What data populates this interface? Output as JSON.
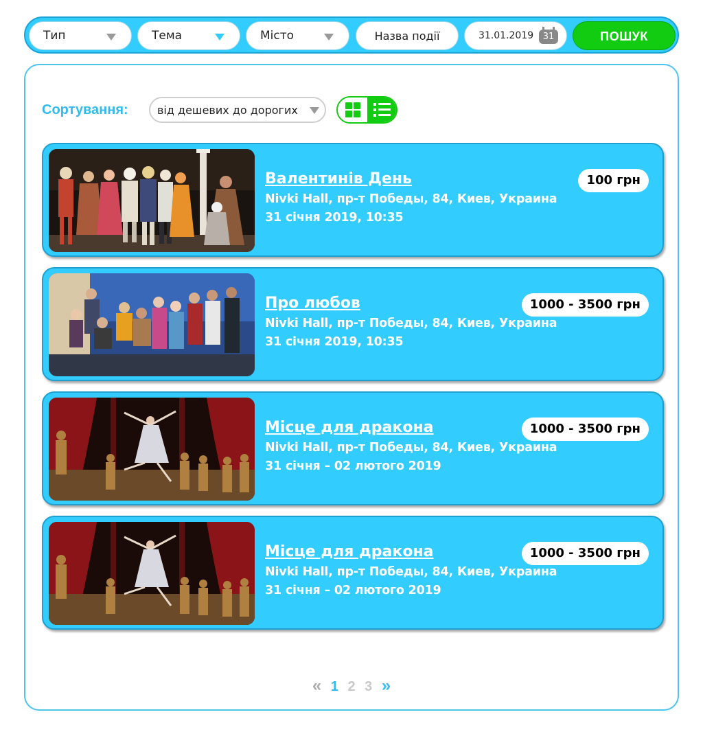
{
  "filters": {
    "type_label": "Тип",
    "theme_label": "Тема",
    "city_label": "Місто",
    "name_placeholder": "Назва події",
    "date_value": "31.01.2019",
    "calendar_day": "31",
    "search_label": "ПОШУК"
  },
  "sort": {
    "label": "Сортування:",
    "selected": "від дешевих до дорогих"
  },
  "view_toggle": {
    "active": "list"
  },
  "events": [
    {
      "title": "Валентинів День",
      "venue": "Nivki Hall, пр-т Победы, 84, Киев, Украина",
      "date": "31 січня 2019, 10:35",
      "price": "100 грн",
      "image": "theatre-costume-cast-photo"
    },
    {
      "title": "Про любов",
      "venue": "Nivki Hall, пр-т Победы, 84, Киев, Украина",
      "date": "31 січня 2019, 10:35",
      "price": "1000 - 3500 грн",
      "image": "comedy-troupe-photo"
    },
    {
      "title": "Місце для дракона",
      "venue": "Nivki Hall, пр-т Победы, 84, Киев, Украина",
      "date": "31 січня – 02 лютого 2019",
      "price": "1000 - 3500 грн",
      "image": "ballet-stage-photo"
    },
    {
      "title": "Місце для дракона",
      "venue": "Nivki Hall, пр-т Победы, 84, Киев, Украина",
      "date": "31 січня – 02 лютого 2019",
      "price": "1000 - 3500 грн",
      "image": "ballet-stage-photo"
    }
  ],
  "pagination": {
    "prev": "«",
    "pages": [
      "1",
      "2",
      "3"
    ],
    "current": "1",
    "next": "»"
  },
  "colors": {
    "accent": "#33ccff",
    "search_green": "#11cc11",
    "panel_border": "#4cc4ec"
  }
}
